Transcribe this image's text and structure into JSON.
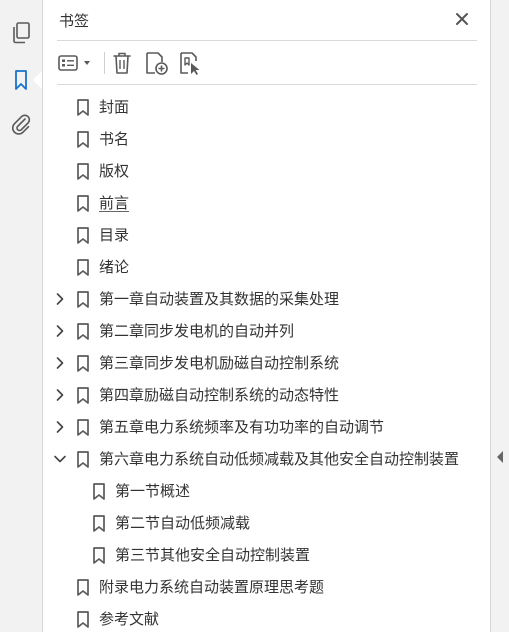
{
  "panel": {
    "title": "书签"
  },
  "rail": {
    "items": [
      {
        "icon": "pages-icon"
      },
      {
        "icon": "bookmark-icon",
        "active": true
      },
      {
        "icon": "attachment-icon"
      }
    ]
  },
  "toolbar": {
    "items": [
      "options-menu-icon",
      "delete-icon",
      "new-bookmark-icon",
      "bookmark-from-selection-icon"
    ]
  },
  "bookmarks": [
    {
      "label": "封面",
      "level": 0,
      "expander": "none"
    },
    {
      "label": "书名",
      "level": 0,
      "expander": "none"
    },
    {
      "label": "版权",
      "level": 0,
      "expander": "none"
    },
    {
      "label": "前言",
      "level": 0,
      "expander": "none",
      "underlined": true
    },
    {
      "label": "目录",
      "level": 0,
      "expander": "none"
    },
    {
      "label": "绪论",
      "level": 0,
      "expander": "none"
    },
    {
      "label": "第一章自动装置及其数据的采集处理",
      "level": 0,
      "expander": "collapsed"
    },
    {
      "label": "第二章同步发电机的自动并列",
      "level": 0,
      "expander": "collapsed"
    },
    {
      "label": "第三章同步发电机励磁自动控制系统",
      "level": 0,
      "expander": "collapsed"
    },
    {
      "label": "第四章励磁自动控制系统的动态特性",
      "level": 0,
      "expander": "collapsed"
    },
    {
      "label": "第五章电力系统频率及有功功率的自动调节",
      "level": 0,
      "expander": "collapsed"
    },
    {
      "label": "第六章电力系统自动低频减载及其他安全自动控制装置",
      "level": 0,
      "expander": "expanded"
    },
    {
      "label": "第一节概述",
      "level": 1,
      "expander": "none"
    },
    {
      "label": "第二节自动低频减载",
      "level": 1,
      "expander": "none"
    },
    {
      "label": "第三节其他安全自动控制装置",
      "level": 1,
      "expander": "none"
    },
    {
      "label": "附录电力系统自动装置原理思考题",
      "level": 0,
      "expander": "none"
    },
    {
      "label": "参考文献",
      "level": 0,
      "expander": "none"
    }
  ],
  "colors": {
    "accent": "#1a73c9",
    "icon": "#5a5a5a",
    "rail_bg": "#f2f2f2"
  }
}
